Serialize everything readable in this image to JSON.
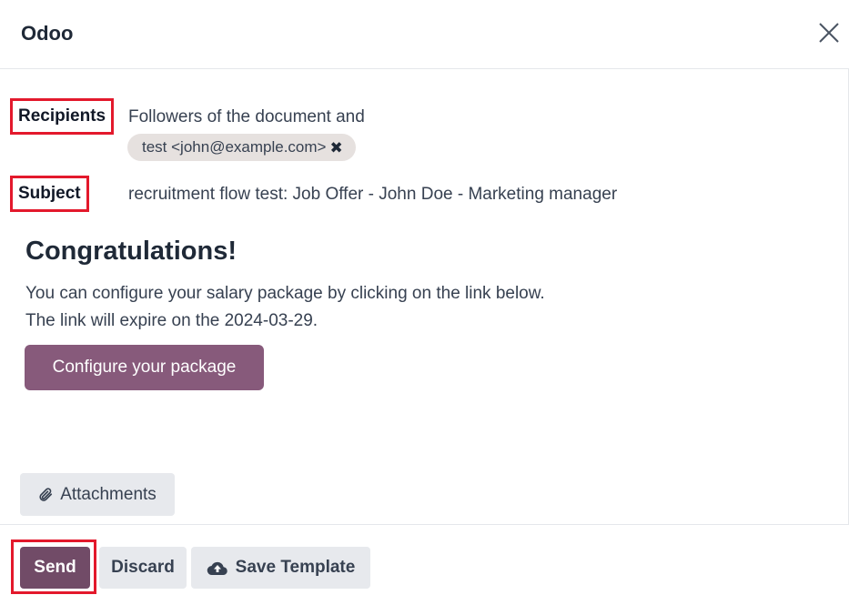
{
  "dialog": {
    "title": "Odoo",
    "close_icon": "close-icon"
  },
  "fields": {
    "recipients_label": "Recipients",
    "recipients_prefix": "Followers of the document and",
    "recipient_tag": "test <john@example.com>",
    "tag_remove_icon": "x-icon",
    "subject_label": "Subject",
    "subject_value": "recruitment flow test: Job Offer - John Doe - Marketing manager"
  },
  "body": {
    "heading": "Congratulations!",
    "line1": "You can configure your salary package by clicking on the link below.",
    "line2": "The link will expire on the 2024-03-29.",
    "configure_button": "Configure your package",
    "attachments_button": "Attachments",
    "attachments_icon": "paperclip-icon"
  },
  "footer": {
    "send_button": "Send",
    "discard_button": "Discard",
    "save_template_button": "Save Template",
    "save_template_icon": "cloud-upload-icon"
  },
  "colors": {
    "primary": "#714b67",
    "configure_button": "#875a7b",
    "highlight": "#e3192c",
    "secondary_button": "#e7e9ed"
  }
}
